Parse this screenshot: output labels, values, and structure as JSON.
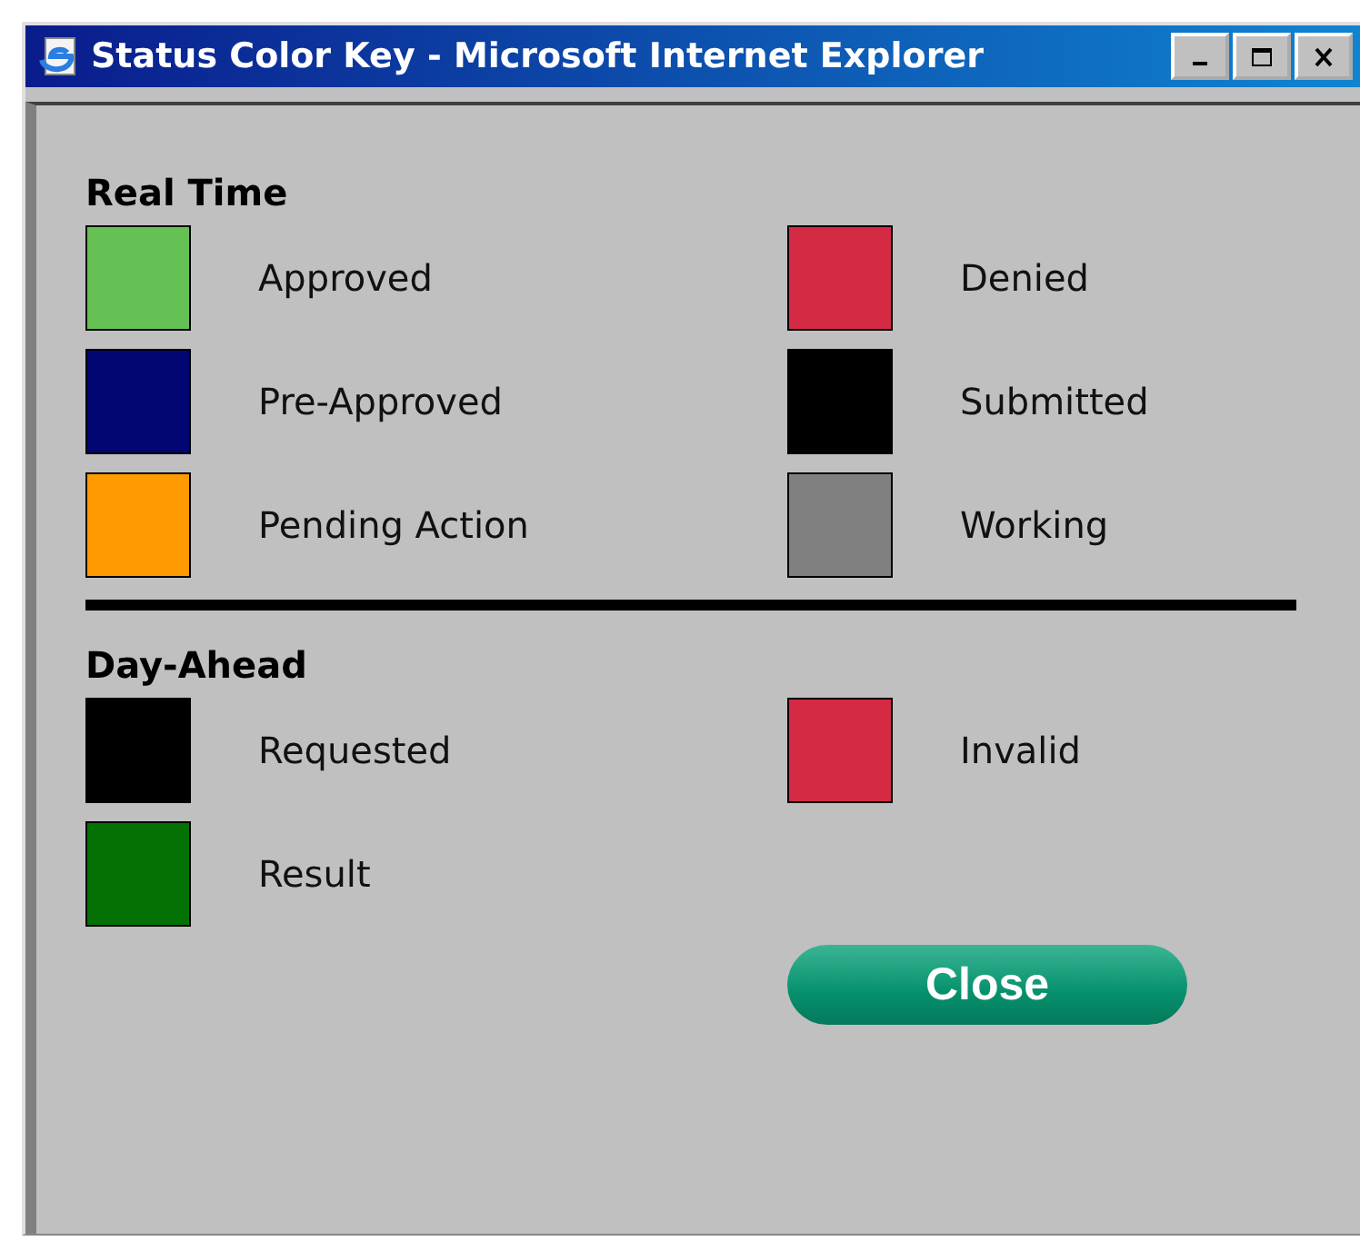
{
  "window": {
    "title": "Status Color Key - Microsoft Internet Explorer"
  },
  "sections": [
    {
      "title": "Real Time",
      "items": [
        {
          "label": "Approved",
          "color": "#66c155"
        },
        {
          "label": "Denied",
          "color": "#d42a44"
        },
        {
          "label": "Pre-Approved",
          "color": "#010672"
        },
        {
          "label": "Submitted",
          "color": "#000000"
        },
        {
          "label": "Pending Action",
          "color": "#ff9a00"
        },
        {
          "label": "Working",
          "color": "#808080"
        }
      ]
    },
    {
      "title": "Day-Ahead",
      "items": [
        {
          "label": "Requested",
          "color": "#000000"
        },
        {
          "label": "Invalid",
          "color": "#d42a44"
        },
        {
          "label": "Result",
          "color": "#037103"
        }
      ]
    }
  ],
  "button": {
    "label": "Close"
  }
}
